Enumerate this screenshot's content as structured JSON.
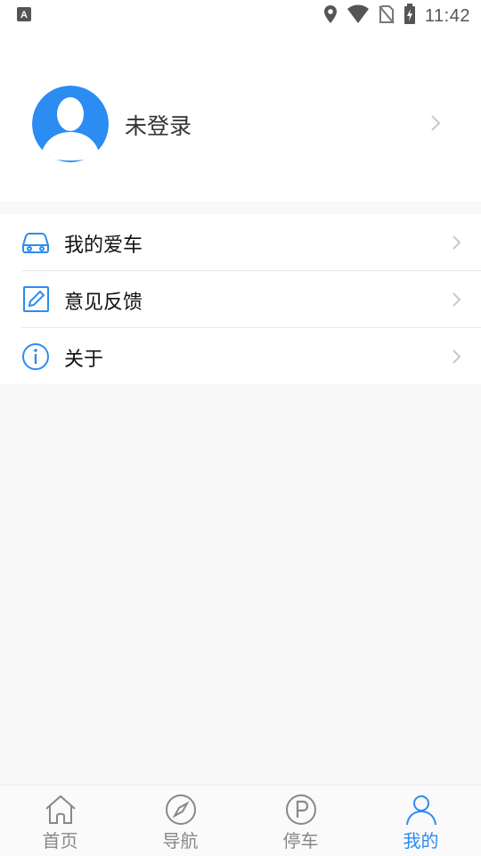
{
  "status_bar": {
    "time": "11:42",
    "icons": [
      "keyboard-icon",
      "location-icon",
      "wifi-icon",
      "no-sim-icon",
      "battery-charging-icon"
    ]
  },
  "profile": {
    "name": "未登录",
    "avatar_icon": "default-avatar-icon"
  },
  "menu": {
    "items": [
      {
        "label": "我的爱车",
        "icon": "car-icon"
      },
      {
        "label": "意见反馈",
        "icon": "edit-icon"
      },
      {
        "label": "关于",
        "icon": "info-icon"
      }
    ]
  },
  "tabs": [
    {
      "label": "首页",
      "icon": "home-icon",
      "active": false
    },
    {
      "label": "导航",
      "icon": "compass-icon",
      "active": false
    },
    {
      "label": "停车",
      "icon": "parking-icon",
      "active": false
    },
    {
      "label": "我的",
      "icon": "user-icon",
      "active": true
    }
  ],
  "colors": {
    "accent": "#2b8cf2",
    "inactive": "#888888",
    "avatar_bg": "#2b8cf2",
    "background": "#f8f8f8"
  }
}
